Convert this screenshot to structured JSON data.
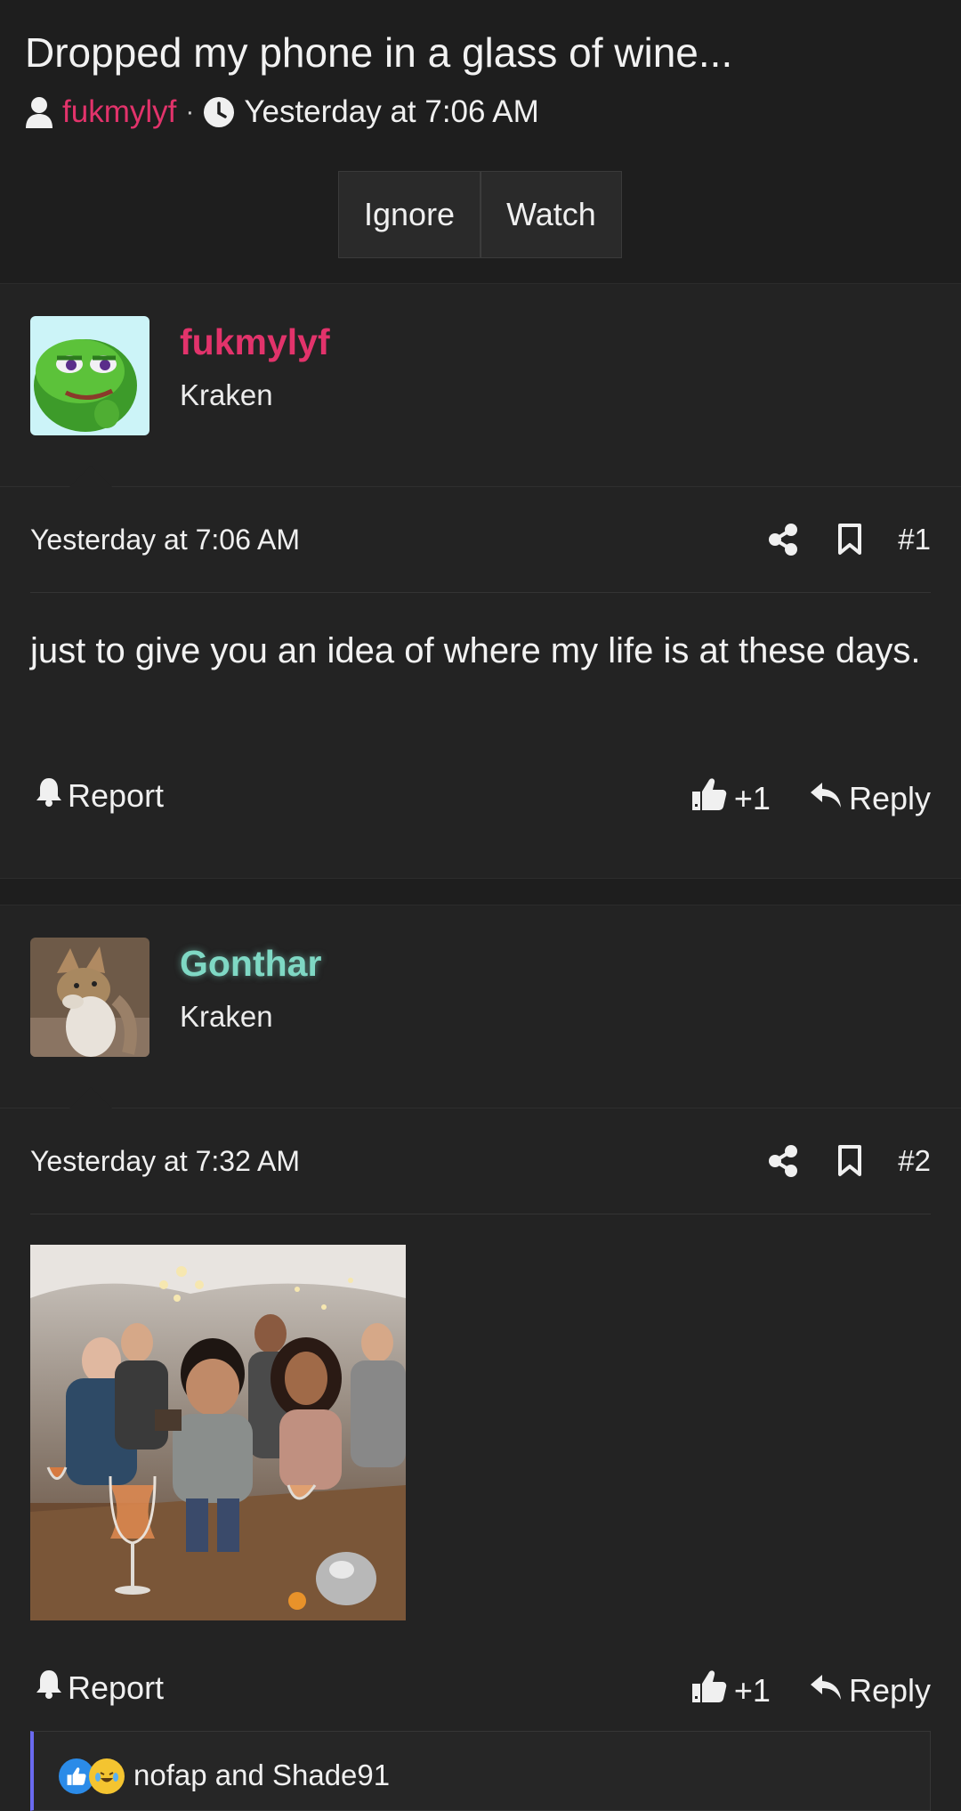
{
  "thread": {
    "title": "Dropped my phone in a glass of wine...",
    "author": "fukmylyf",
    "separator": "·",
    "time": "Yesterday at 7:06 AM",
    "buttons": {
      "ignore": "Ignore",
      "watch": "Watch"
    }
  },
  "posts": [
    {
      "username": "fukmylyf",
      "username_color": "#e2336b",
      "user_title": "Kraken",
      "date": "Yesterday at 7:06 AM",
      "number": "#1",
      "body": "just to give you an idea of where my life is at these days.",
      "report_label": "Report",
      "likes": "+1",
      "reply_label": "Reply"
    },
    {
      "username": "Gonthar",
      "username_color": "#7fd8c4",
      "user_title": "Kraken",
      "date": "Yesterday at 7:32 AM",
      "number": "#2",
      "report_label": "Report",
      "likes": "+1",
      "reply_label": "Reply"
    }
  ],
  "reactions": {
    "text": "nofap and Shade91",
    "icons": [
      "like-reaction-icon",
      "laugh-cry-reaction-icon"
    ]
  },
  "icons": {
    "user": "user-icon",
    "clock": "clock-icon",
    "share": "share-icon",
    "bookmark": "bookmark-icon",
    "bell": "bell-icon",
    "thumbs_up": "thumbs-up-icon",
    "reply": "reply-icon"
  }
}
